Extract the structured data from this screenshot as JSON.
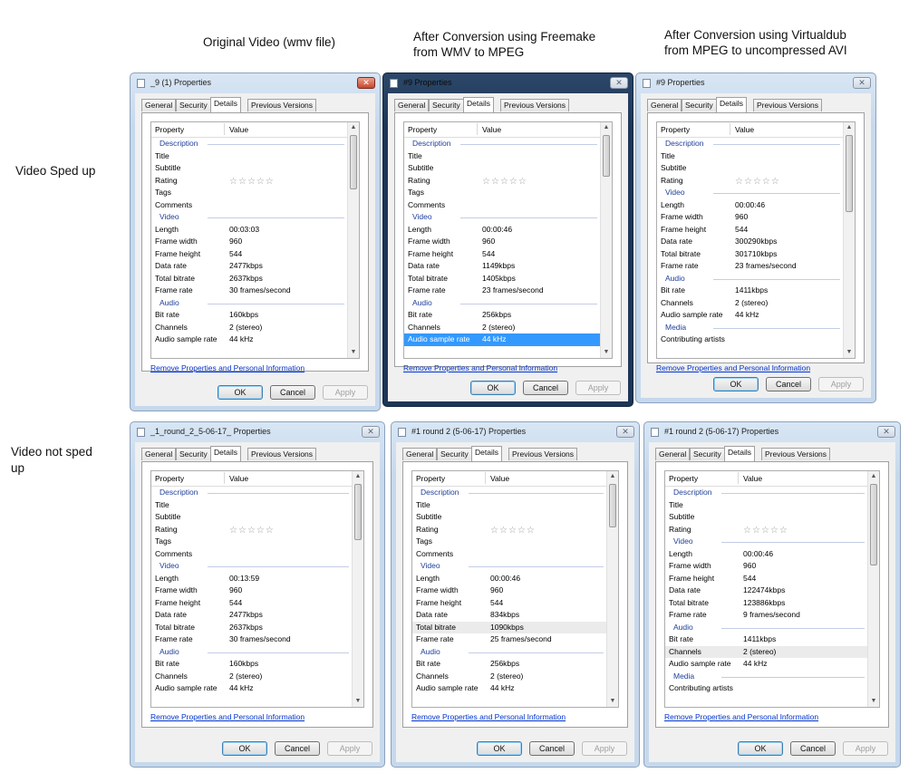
{
  "labels": {
    "original": "Original Video  (wmv file)",
    "freemake_line1": "After Conversion using Freemake",
    "freemake_line2": "from WMV to MPEG",
    "virtualdub_line1": "After Conversion using Virtualdub",
    "virtualdub_line2": "from MPEG to uncompressed AVI",
    "sped_up": "Video Sped up",
    "not_sped_line1": "Video not sped",
    "not_sped_line2": "up"
  },
  "tabs": [
    "General",
    "Security",
    "Details",
    "Previous Versions"
  ],
  "header": {
    "property": "Property",
    "value": "Value"
  },
  "link": "Remove Properties and Personal Information",
  "buttons": {
    "ok": "OK",
    "cancel": "Cancel",
    "apply": "Apply"
  },
  "colors": {
    "accent": "#3399ff",
    "section": "#1f3f9a",
    "link": "#0033cc"
  },
  "windows": [
    {
      "title": "_9 (1) Properties",
      "rows": [
        {
          "type": "section",
          "p": "Description"
        },
        {
          "p": "Title",
          "v": ""
        },
        {
          "p": "Subtitle",
          "v": ""
        },
        {
          "p": "Rating",
          "v": "",
          "stars": true
        },
        {
          "p": "Tags",
          "v": ""
        },
        {
          "p": "Comments",
          "v": ""
        },
        {
          "type": "section",
          "p": "Video"
        },
        {
          "p": "Length",
          "v": "00:03:03"
        },
        {
          "p": "Frame width",
          "v": "960"
        },
        {
          "p": "Frame height",
          "v": "544"
        },
        {
          "p": "Data rate",
          "v": "2477kbps"
        },
        {
          "p": "Total bitrate",
          "v": "2637kbps"
        },
        {
          "p": "Frame rate",
          "v": "30 frames/second"
        },
        {
          "type": "section",
          "p": "Audio"
        },
        {
          "p": "Bit rate",
          "v": "160kbps"
        },
        {
          "p": "Channels",
          "v": "2 (stereo)"
        },
        {
          "p": "Audio sample rate",
          "v": "44 kHz"
        }
      ]
    },
    {
      "title": "#9 Properties",
      "rows": [
        {
          "type": "section",
          "p": "Description"
        },
        {
          "p": "Title",
          "v": ""
        },
        {
          "p": "Subtitle",
          "v": ""
        },
        {
          "p": "Rating",
          "v": "",
          "stars": true
        },
        {
          "p": "Tags",
          "v": ""
        },
        {
          "p": "Comments",
          "v": ""
        },
        {
          "type": "section",
          "p": "Video"
        },
        {
          "p": "Length",
          "v": "00:00:46"
        },
        {
          "p": "Frame width",
          "v": "960"
        },
        {
          "p": "Frame height",
          "v": "544"
        },
        {
          "p": "Data rate",
          "v": "1149kbps"
        },
        {
          "p": "Total bitrate",
          "v": "1405kbps"
        },
        {
          "p": "Frame rate",
          "v": "23 frames/second"
        },
        {
          "type": "section",
          "p": "Audio"
        },
        {
          "p": "Bit rate",
          "v": "256kbps"
        },
        {
          "p": "Channels",
          "v": "2 (stereo)"
        },
        {
          "p": "Audio sample rate",
          "v": "44 kHz",
          "sel": true
        }
      ]
    },
    {
      "title": "#9 Properties",
      "rows": [
        {
          "type": "section",
          "p": "Description"
        },
        {
          "p": "Title",
          "v": ""
        },
        {
          "p": "Subtitle",
          "v": ""
        },
        {
          "p": "Rating",
          "v": "",
          "stars": true
        },
        {
          "type": "section",
          "p": "Video"
        },
        {
          "p": "Length",
          "v": "00:00:46"
        },
        {
          "p": "Frame width",
          "v": "960"
        },
        {
          "p": "Frame height",
          "v": "544"
        },
        {
          "p": "Data rate",
          "v": "300290kbps"
        },
        {
          "p": "Total bitrate",
          "v": "301710kbps"
        },
        {
          "p": "Frame rate",
          "v": "23 frames/second"
        },
        {
          "type": "section",
          "p": "Audio"
        },
        {
          "p": "Bit rate",
          "v": "1411kbps"
        },
        {
          "p": "Channels",
          "v": "2 (stereo)"
        },
        {
          "p": "Audio sample rate",
          "v": "44 kHz"
        },
        {
          "type": "section",
          "p": "Media"
        },
        {
          "p": "Contributing artists",
          "v": ""
        }
      ]
    },
    {
      "title": "_1_round_2_5-06-17_ Properties",
      "rows": [
        {
          "type": "section",
          "p": "Description"
        },
        {
          "p": "Title",
          "v": ""
        },
        {
          "p": "Subtitle",
          "v": ""
        },
        {
          "p": "Rating",
          "v": "",
          "stars": true
        },
        {
          "p": "Tags",
          "v": ""
        },
        {
          "p": "Comments",
          "v": ""
        },
        {
          "type": "section",
          "p": "Video"
        },
        {
          "p": "Length",
          "v": "00:13:59"
        },
        {
          "p": "Frame width",
          "v": "960"
        },
        {
          "p": "Frame height",
          "v": "544"
        },
        {
          "p": "Data rate",
          "v": "2477kbps"
        },
        {
          "p": "Total bitrate",
          "v": "2637kbps"
        },
        {
          "p": "Frame rate",
          "v": "30 frames/second"
        },
        {
          "type": "section",
          "p": "Audio"
        },
        {
          "p": "Bit rate",
          "v": "160kbps"
        },
        {
          "p": "Channels",
          "v": "2 (stereo)"
        },
        {
          "p": "Audio sample rate",
          "v": "44 kHz"
        }
      ]
    },
    {
      "title": "#1 round 2 (5-06-17) Properties",
      "rows": [
        {
          "type": "section",
          "p": "Description"
        },
        {
          "p": "Title",
          "v": ""
        },
        {
          "p": "Subtitle",
          "v": ""
        },
        {
          "p": "Rating",
          "v": "",
          "stars": true
        },
        {
          "p": "Tags",
          "v": ""
        },
        {
          "p": "Comments",
          "v": ""
        },
        {
          "type": "section",
          "p": "Video"
        },
        {
          "p": "Length",
          "v": "00:00:46"
        },
        {
          "p": "Frame width",
          "v": "960"
        },
        {
          "p": "Frame height",
          "v": "544"
        },
        {
          "p": "Data rate",
          "v": "834kbps"
        },
        {
          "p": "Total bitrate",
          "v": "1090kbps",
          "hl": true
        },
        {
          "p": "Frame rate",
          "v": "25 frames/second"
        },
        {
          "type": "section",
          "p": "Audio"
        },
        {
          "p": "Bit rate",
          "v": "256kbps"
        },
        {
          "p": "Channels",
          "v": "2 (stereo)"
        },
        {
          "p": "Audio sample rate",
          "v": "44 kHz"
        }
      ]
    },
    {
      "title": "#1 round 2 (5-06-17) Properties",
      "rows": [
        {
          "type": "section",
          "p": "Description"
        },
        {
          "p": "Title",
          "v": ""
        },
        {
          "p": "Subtitle",
          "v": ""
        },
        {
          "p": "Rating",
          "v": "",
          "stars": true
        },
        {
          "type": "section",
          "p": "Video"
        },
        {
          "p": "Length",
          "v": "00:00:46"
        },
        {
          "p": "Frame width",
          "v": "960"
        },
        {
          "p": "Frame height",
          "v": "544"
        },
        {
          "p": "Data rate",
          "v": "122474kbps"
        },
        {
          "p": "Total bitrate",
          "v": "123886kbps"
        },
        {
          "p": "Frame rate",
          "v": "9 frames/second"
        },
        {
          "type": "section",
          "p": "Audio"
        },
        {
          "p": "Bit rate",
          "v": "1411kbps"
        },
        {
          "p": "Channels",
          "v": "2 (stereo)",
          "hl": true
        },
        {
          "p": "Audio sample rate",
          "v": "44 kHz"
        },
        {
          "type": "section",
          "p": "Media"
        },
        {
          "p": "Contributing artists",
          "v": ""
        }
      ]
    }
  ]
}
